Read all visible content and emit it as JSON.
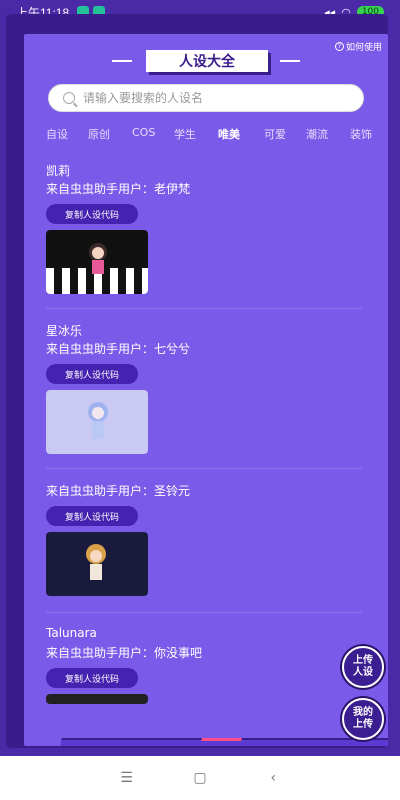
{
  "status": {
    "time": "上午11:18",
    "battery": "100"
  },
  "header": {
    "title": "人设大全",
    "help_label": "如何使用"
  },
  "search": {
    "placeholder": "请输入要搜索的人设名"
  },
  "tabs": [
    {
      "label": "自设",
      "active": false
    },
    {
      "label": "原创",
      "active": false
    },
    {
      "label": "COS",
      "active": false
    },
    {
      "label": "学生",
      "active": false
    },
    {
      "label": "唯美",
      "active": true
    },
    {
      "label": "可爱",
      "active": false
    },
    {
      "label": "潮流",
      "active": false
    },
    {
      "label": "装饰",
      "active": false
    }
  ],
  "items": [
    {
      "name": "凯莉",
      "from": "来自虫虫助手用户：老伊梵",
      "copy_label": "复制人设代码"
    },
    {
      "name": "星冰乐",
      "from": "来自虫虫助手用户：七兮兮",
      "copy_label": "复制人设代码"
    },
    {
      "name": "",
      "from": "来自虫虫助手用户：圣铃元",
      "copy_label": "复制人设代码"
    },
    {
      "name": "Talunara",
      "from": "来自虫虫助手用户：你没事吧",
      "copy_label": "复制人设代码"
    }
  ],
  "fab": {
    "upload_label": "上传\n人设",
    "mine_label": "我的\n上传"
  },
  "nav": {
    "menu_icon": "menu-icon",
    "home_icon": "home-icon",
    "back_icon": "back-icon"
  }
}
